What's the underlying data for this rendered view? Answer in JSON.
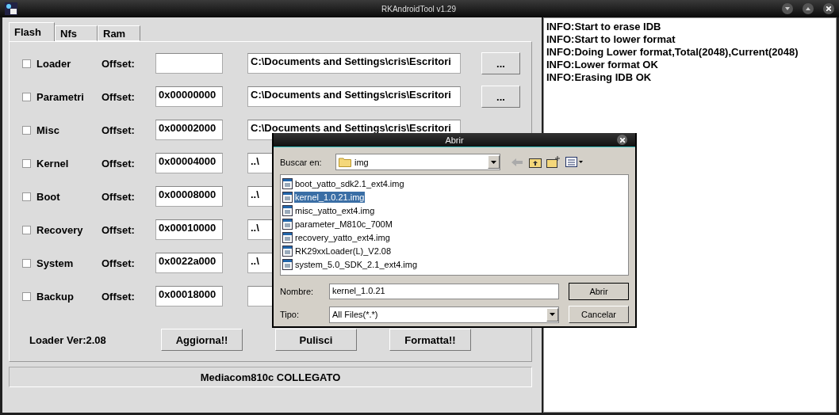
{
  "window": {
    "title": "RKAndroidTool v1.29"
  },
  "tabs": [
    {
      "label": "Flash",
      "selected": true
    },
    {
      "label": "Nfs",
      "selected": false
    },
    {
      "label": "Ram",
      "selected": false
    }
  ],
  "partitions": [
    {
      "name": "Loader",
      "checked": false,
      "offset_label": "Offset:",
      "path": "C:\\Documents and Settings\\cris\\Escritori",
      "browse": "..."
    },
    {
      "name": "Parametri",
      "checked": false,
      "offset_label": "Offset:",
      "offset": "0x00000000",
      "path": "C:\\Documents and Settings\\cris\\Escritori",
      "browse": "..."
    },
    {
      "name": "Misc",
      "checked": false,
      "offset_label": "Offset:",
      "offset": "0x00002000",
      "path": "C:\\Documents and Settings\\cris\\Escritori"
    },
    {
      "name": "Kernel",
      "checked": false,
      "offset_label": "Offset:",
      "offset": "0x00004000",
      "path": "..\\"
    },
    {
      "name": "Boot",
      "checked": false,
      "offset_label": "Offset:",
      "offset": "0x00008000",
      "path": "..\\"
    },
    {
      "name": "Recovery",
      "checked": false,
      "offset_label": "Offset:",
      "offset": "0x00010000",
      "path": "..\\"
    },
    {
      "name": "System",
      "checked": false,
      "offset_label": "Offset:",
      "offset": "0x0022a000",
      "path": "..\\"
    },
    {
      "name": "Backup",
      "checked": false,
      "offset_label": "Offset:",
      "offset": "0x00018000"
    }
  ],
  "loader_version": "Loader Ver:2.08",
  "actions": [
    "Aggiorna!!",
    "Pulisci",
    "Formatta!!"
  ],
  "status": "Mediacom810c COLLEGATO",
  "log": [
    "INFO:Start to erase IDB",
    "INFO:Start to lower format",
    "INFO:Doing Lower format,Total(2048),Current(2048)",
    "INFO:Lower format OK",
    "INFO:Erasing IDB OK"
  ],
  "dialog": {
    "title": "Abrir",
    "look_in_label": "Buscar en:",
    "look_in": "img",
    "files": [
      {
        "name": "boot_yatto_sdk2.1_ext4.img",
        "selected": false
      },
      {
        "name": "kernel_1.0.21.img",
        "selected": true
      },
      {
        "name": "misc_yatto_ext4.img",
        "selected": false
      },
      {
        "name": "parameter_M810c_700M",
        "selected": false
      },
      {
        "name": "recovery_yatto_ext4.img",
        "selected": false
      },
      {
        "name": "RK29xxLoader(L)_V2.08",
        "selected": false
      },
      {
        "name": "system_5.0_SDK_2.1_ext4.img",
        "selected": false
      }
    ],
    "name_label": "Nombre:",
    "name_value": "kernel_1.0.21",
    "type_label": "Tipo:",
    "type_value": "All Files(*.*)",
    "buttons": [
      "Abrir",
      "Cancelar"
    ]
  }
}
